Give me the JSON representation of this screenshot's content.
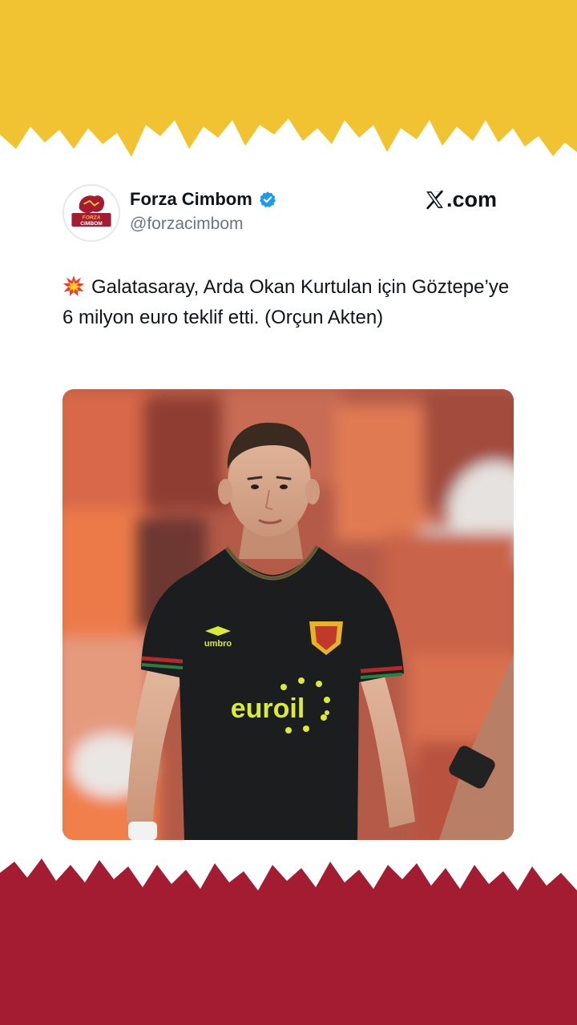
{
  "colors": {
    "top_band": "#f1c232",
    "bottom_band": "#a31c32",
    "verified": "#1d9bf0",
    "text": "#0f1419",
    "muted": "#6b7680",
    "jersey": "#1b1d1f",
    "jersey_text": "#d9ea3a"
  },
  "header": {
    "display_name": "Forza Cimbom",
    "handle": "@forzacimbom",
    "verified_icon": "verified-badge-icon",
    "site_label": ".com",
    "site_icon": "x-logo-icon",
    "avatar_logo_text": [
      "FORZA",
      "CIMBOM"
    ]
  },
  "tweet": {
    "emoji_icon": "collision-icon",
    "text": "Galatasaray, Arda Okan Kurtulan için Göztepe’ye 6 milyon euro teklif etti. (Orçun Akten)"
  },
  "photo": {
    "jersey_sponsor": "euroil",
    "kit_brand": "umbro"
  }
}
